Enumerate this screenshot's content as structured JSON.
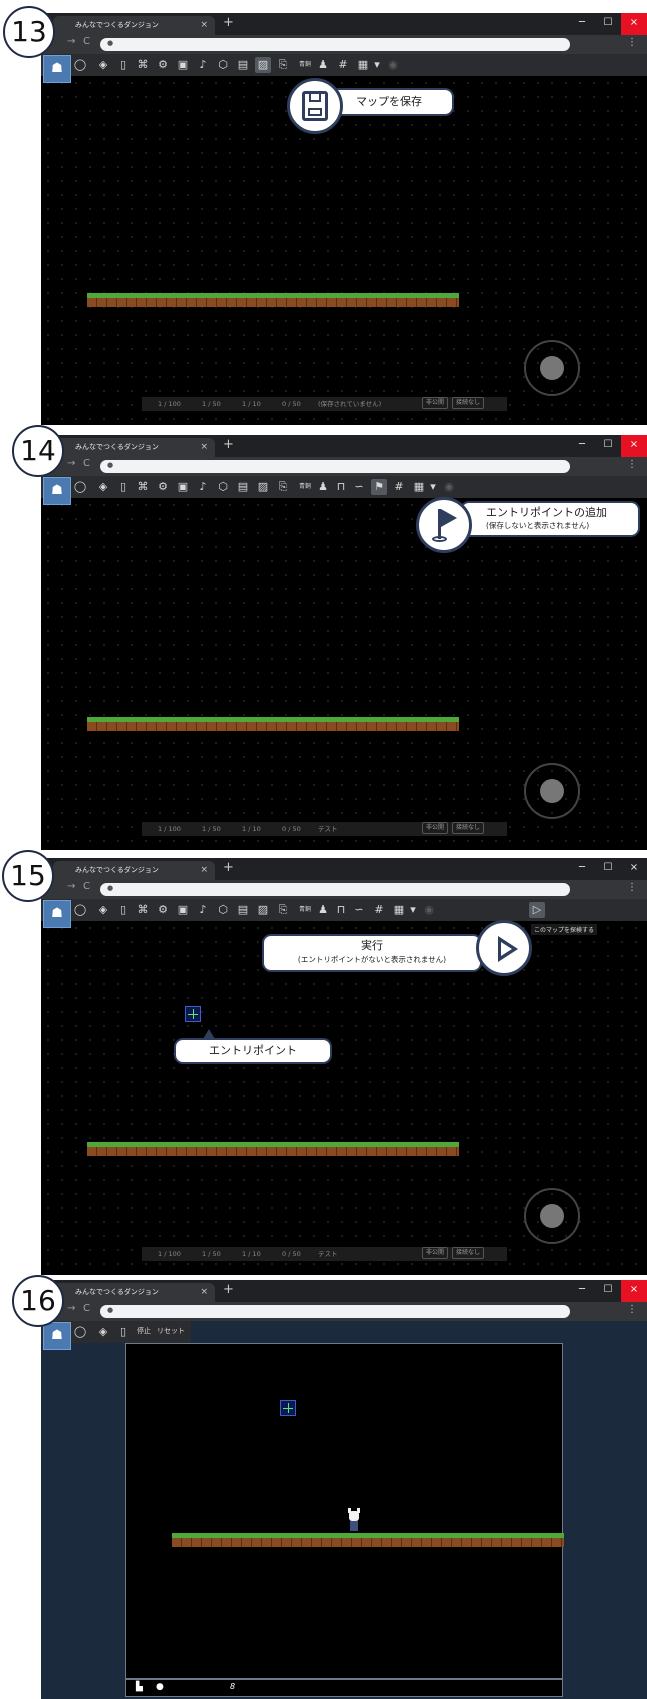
{
  "browser": {
    "tab_title": "みんなでつくるダンジョン",
    "tab_close": "×",
    "new_tab": "+",
    "minimize": "─",
    "maximize": "☐",
    "close": "×",
    "back": "←",
    "forward": "→",
    "reload": "C",
    "lock": "🔒",
    "menu": "⋮"
  },
  "toolbar": {
    "lighting_label": "青銅",
    "grid_dropdown": "▾",
    "stop_label": "停止",
    "reset_label": "リセット"
  },
  "icons": {
    "logo": "logo-icon",
    "speech": "speech-bubble-icon",
    "layers": "layers-icon",
    "page": "page-icon",
    "gamepad": "gamepad-icon",
    "gear": "gear-icon",
    "cube": "cube-icon",
    "image": "image-icon",
    "music": "music-note-icon",
    "box": "box-icon",
    "film": "film-icon",
    "save": "save-icon",
    "export": "export-icon",
    "person": "person-icon",
    "lock": "lock-icon",
    "route": "route-icon",
    "entry_flag": "entry-flag-icon",
    "hashtag": "hashtag-icon",
    "grid": "grid-icon",
    "play": "play-icon"
  },
  "steps": [
    "13",
    "14",
    "15",
    "16"
  ],
  "step13": {
    "callout": "マップを保存",
    "status": {
      "objects": "1 / 100",
      "tiles": "1 / 50",
      "images": "1 / 10",
      "links": "0 / 50",
      "title": "(保存されていません)",
      "private": "非公開",
      "connection": "接続なし"
    }
  },
  "step14": {
    "callout_main": "エントリポイントの追加",
    "callout_sub": "(保存しないと表示されません)",
    "tooltip": "エントリポイントの追加",
    "status": {
      "objects": "1 / 100",
      "tiles": "1 / 50",
      "images": "1 / 10",
      "links": "0 / 50",
      "title": "テスト",
      "private": "非公開",
      "connection": "接続なし"
    }
  },
  "step15": {
    "run_main": "実行",
    "run_sub": "(エントリポイントがないと表示されません)",
    "run_tooltip": "このマップを探検する",
    "entry_label": "エントリポイント",
    "status": {
      "objects": "1 / 100",
      "tiles": "1 / 50",
      "images": "1 / 10",
      "links": "0 / 50",
      "title": "テスト",
      "private": "非公開",
      "connection": "接続なし"
    }
  },
  "step16": {
    "counter": "8"
  }
}
